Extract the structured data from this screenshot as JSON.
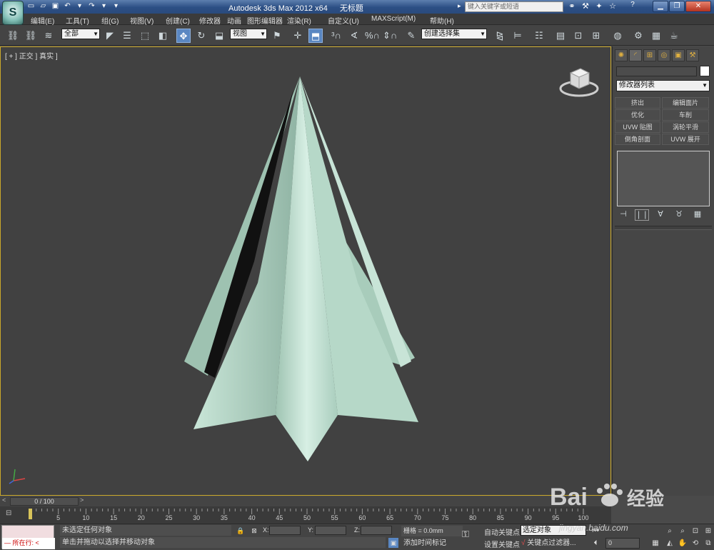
{
  "window": {
    "app_name": "Autodesk 3ds Max  2012 x64",
    "doc_title": "无标题",
    "search_placeholder": "键入关键字或短语",
    "help_label": "?"
  },
  "menu": [
    "编辑(E)",
    "工具(T)",
    "组(G)",
    "视图(V)",
    "创建(C)",
    "修改器",
    "动画",
    "图形编辑器",
    "渲染(R)",
    "自定义(U)",
    "MAXScript(M)",
    "帮助(H)"
  ],
  "toolbar": {
    "selection_filter": "全部",
    "ref_coord": "视图",
    "named_selection": "创建选择集"
  },
  "viewport": {
    "label": "[ + ] 正交 ] 真实 ]",
    "cone_color": "#c5e3d4",
    "background": "#414141"
  },
  "command_panel": {
    "modifier_list": "修改器列表",
    "modifier_buttons": [
      "挤出",
      "编辑面片",
      "优化",
      "车削",
      "UVW 贴图",
      "涡轮平滑",
      "倒角剖面",
      "UVW 展开"
    ]
  },
  "timeline": {
    "frame_display": "0 / 100",
    "ticks": [
      5,
      10,
      15,
      20,
      25,
      30,
      35,
      40,
      45,
      50,
      55,
      60,
      65,
      70,
      75,
      80,
      85,
      90,
      95,
      100
    ]
  },
  "status": {
    "listener_text": "所在行:",
    "selection_msg": "未选定任何对象",
    "prompt_msg": "单击并拖动以选择并移动对象",
    "x_label": "X:",
    "y_label": "Y:",
    "z_label": "Z:",
    "grid": "栅格 = 0.0mm",
    "add_time_tag": "添加时间标记",
    "auto_key": "自动关键点",
    "set_key": "设置关键点",
    "selected_objects": "选定对象",
    "key_filters": "关键点过滤器...",
    "frame_value": "0"
  },
  "watermark": {
    "brand": "Bai",
    "brand2": "du",
    "cn": "经验",
    "url": "jingyan.baidu.com"
  }
}
